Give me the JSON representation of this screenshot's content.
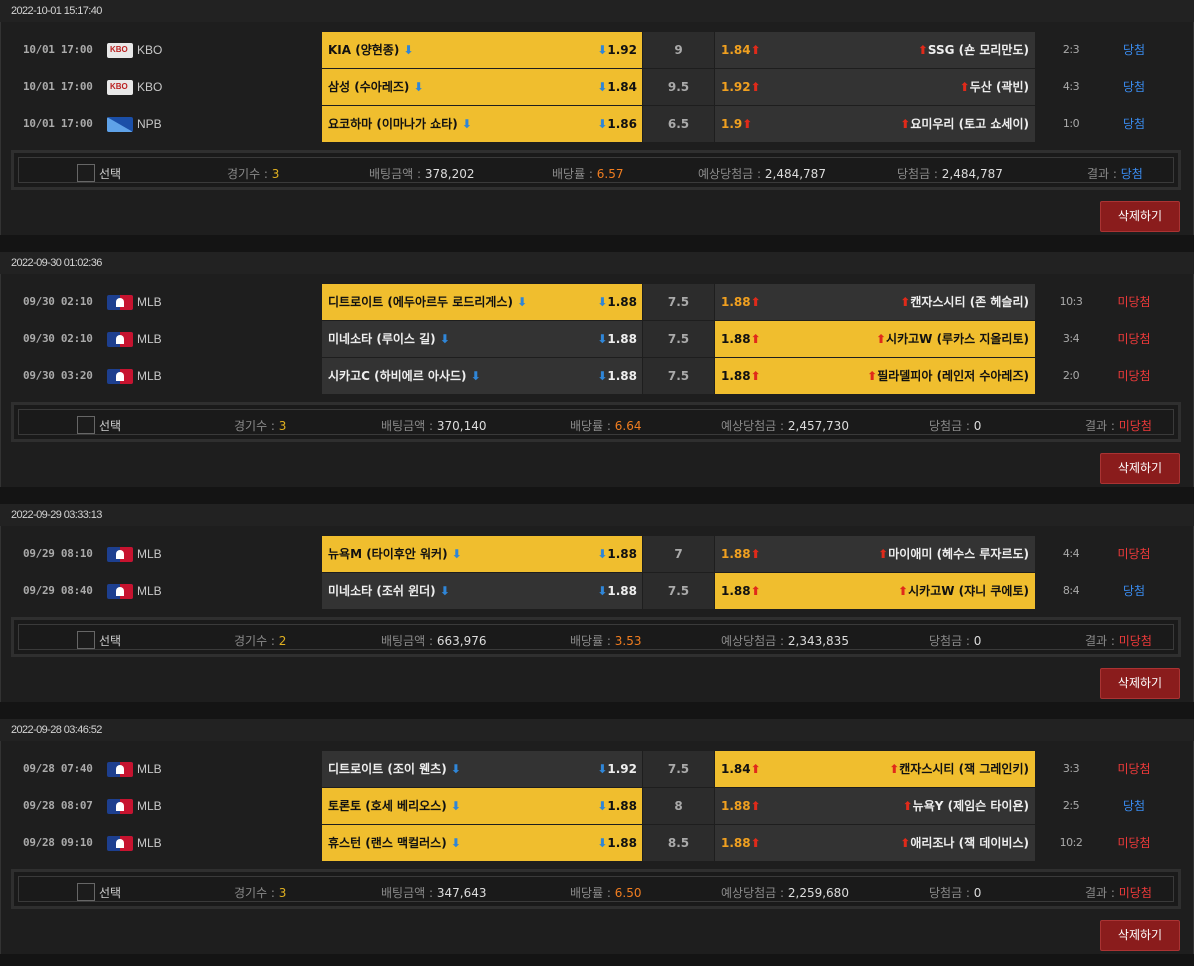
{
  "labels": {
    "select": "선택",
    "games": "경기수 : ",
    "bet": "배팅금액 : ",
    "odds": "배당률 : ",
    "expected": "예상당첨금 : ",
    "won": "당첨금 : ",
    "result": "결과 : ",
    "delete": "삭제하기"
  },
  "colors": {
    "selected": "#f0be2e",
    "win": "#3a8cf0",
    "lose": "#ee3a3a",
    "delete_button": "#8a1c1c"
  },
  "bets": [
    {
      "header": "2022-10-01 15:17:40",
      "games": [
        {
          "date": "10/01 17:00",
          "league": "KBO",
          "logo": "kbo-logo",
          "home": "KIA (양현종)",
          "home_odds": "1.92",
          "handicap": "9",
          "away_odds": "1.84",
          "away": "SSG (숀 모리만도)",
          "pick": "home",
          "score": "2:3",
          "result": "당첨",
          "status": "win"
        },
        {
          "date": "10/01 17:00",
          "league": "KBO",
          "logo": "kbo-logo",
          "home": "삼성 (수아레즈)",
          "home_odds": "1.84",
          "handicap": "9.5",
          "away_odds": "1.92",
          "away": "두산 (곽빈)",
          "pick": "home",
          "score": "4:3",
          "result": "당첨",
          "status": "win"
        },
        {
          "date": "10/01 17:00",
          "league": "NPB",
          "logo": "npb-logo",
          "home": "요코하마 (이마나가 쇼타)",
          "home_odds": "1.86",
          "handicap": "6.5",
          "away_odds": "1.9",
          "away": "요미우리 (토고 쇼세이)",
          "pick": "home",
          "score": "1:0",
          "result": "당첨",
          "status": "win"
        }
      ],
      "summary": {
        "games": "3",
        "bet": "378,202",
        "odds": "6.57",
        "expected": "2,484,787",
        "won": "2,484,787",
        "result": "당첨",
        "status": "win"
      }
    },
    {
      "header": "2022-09-30 01:02:36",
      "games": [
        {
          "date": "09/30 02:10",
          "league": "MLB",
          "logo": "mlb-logo",
          "home": "디트로이트 (에두아르두 로드리게스)",
          "home_odds": "1.88",
          "handicap": "7.5",
          "away_odds": "1.88",
          "away": "캔자스시티 (존 헤슬리)",
          "pick": "home",
          "score": "10:3",
          "result": "미당첨",
          "status": "lose"
        },
        {
          "date": "09/30 02:10",
          "league": "MLB",
          "logo": "mlb-logo",
          "home": "미네소타 (루이스 길)",
          "home_odds": "1.88",
          "handicap": "7.5",
          "away_odds": "1.88",
          "away": "시카고W (루카스 지올리토)",
          "pick": "away",
          "score": "3:4",
          "result": "미당첨",
          "status": "lose"
        },
        {
          "date": "09/30 03:20",
          "league": "MLB",
          "logo": "mlb-logo",
          "home": "시카고C (하비에르 아사드)",
          "home_odds": "1.88",
          "handicap": "7.5",
          "away_odds": "1.88",
          "away": "필라델피아 (레인저 수아레즈)",
          "pick": "away",
          "score": "2:0",
          "result": "미당첨",
          "status": "lose"
        }
      ],
      "summary": {
        "games": "3",
        "bet": "370,140",
        "odds": "6.64",
        "expected": "2,457,730",
        "won": "0",
        "result": "미당첨",
        "status": "lose"
      }
    },
    {
      "header": "2022-09-29 03:33:13",
      "games": [
        {
          "date": "09/29 08:10",
          "league": "MLB",
          "logo": "mlb-logo",
          "home": "뉴욕M (타이후안 워커)",
          "home_odds": "1.88",
          "handicap": "7",
          "away_odds": "1.88",
          "away": "마이애미 (헤수스 루자르도)",
          "pick": "home",
          "score": "4:4",
          "result": "미당첨",
          "status": "lose"
        },
        {
          "date": "09/29 08:40",
          "league": "MLB",
          "logo": "mlb-logo",
          "home": "미네소타 (조쉬 윈더)",
          "home_odds": "1.88",
          "handicap": "7.5",
          "away_odds": "1.88",
          "away": "시카고W (쟈니 쿠에토)",
          "pick": "away",
          "score": "8:4",
          "result": "당첨",
          "status": "win"
        }
      ],
      "summary": {
        "games": "2",
        "bet": "663,976",
        "odds": "3.53",
        "expected": "2,343,835",
        "won": "0",
        "result": "미당첨",
        "status": "lose"
      }
    },
    {
      "header": "2022-09-28 03:46:52",
      "games": [
        {
          "date": "09/28 07:40",
          "league": "MLB",
          "logo": "mlb-logo",
          "home": "디트로이트 (조이 웬츠)",
          "home_odds": "1.92",
          "handicap": "7.5",
          "away_odds": "1.84",
          "away": "캔자스시티 (잭 그레인키)",
          "pick": "away",
          "score": "3:3",
          "result": "미당첨",
          "status": "lose"
        },
        {
          "date": "09/28 08:07",
          "league": "MLB",
          "logo": "mlb-logo",
          "home": "토론토 (호세 베리오스)",
          "home_odds": "1.88",
          "handicap": "8",
          "away_odds": "1.88",
          "away": "뉴욕Y (제임슨 타이욘)",
          "pick": "home",
          "score": "2:5",
          "result": "당첨",
          "status": "win"
        },
        {
          "date": "09/28 09:10",
          "league": "MLB",
          "logo": "mlb-logo",
          "home": "휴스턴 (랜스 맥컬러스)",
          "home_odds": "1.88",
          "handicap": "8.5",
          "away_odds": "1.88",
          "away": "애리조나 (잭 데이비스)",
          "pick": "home",
          "score": "10:2",
          "result": "미당첨",
          "status": "lose"
        }
      ],
      "summary": {
        "games": "3",
        "bet": "347,643",
        "odds": "6.50",
        "expected": "2,259,680",
        "won": "0",
        "result": "미당첨",
        "status": "lose"
      }
    }
  ]
}
